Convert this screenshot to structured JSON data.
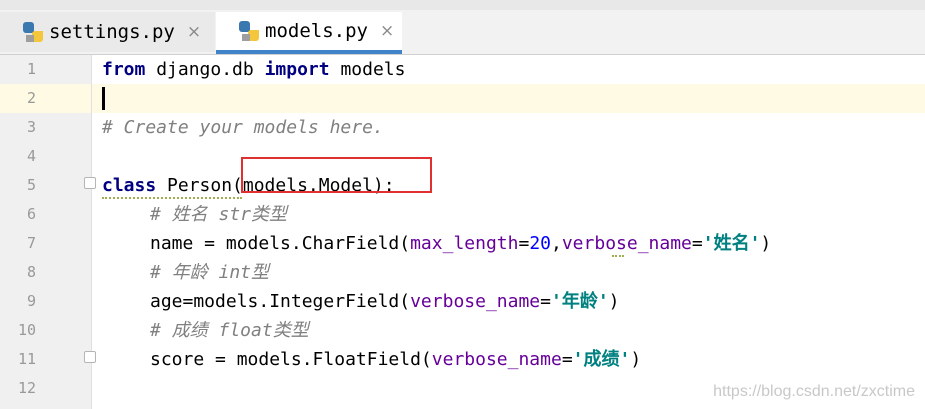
{
  "tabs": [
    {
      "label": "settings.py",
      "icon": "python-file-icon",
      "active": false
    },
    {
      "label": "models.py",
      "icon": "python-file-icon",
      "active": true
    }
  ],
  "close_glyph": "×",
  "line_numbers": [
    "1",
    "2",
    "3",
    "4",
    "5",
    "6",
    "7",
    "8",
    "9",
    "10",
    "11",
    "12"
  ],
  "code": {
    "l1": {
      "kw1": "from",
      "t1": " django.db ",
      "kw2": "import",
      "t2": " models"
    },
    "l3": {
      "comment": "# Create your models here."
    },
    "l5": {
      "kw": "class",
      "t1": " Person",
      "t2": "(models.Model):"
    },
    "l6": {
      "comment": "# 姓名 str类型"
    },
    "l7": {
      "t1": "name = models.CharField(",
      "p1": "max_length",
      "t2": "=",
      "n1": "20",
      "t3": ",",
      "p2": "verbose_name",
      "t4": "=",
      "s1": "'姓名'",
      "t5": ")"
    },
    "l8": {
      "comment": "# 年龄 int型"
    },
    "l9": {
      "t1": "age=models.IntegerField(",
      "p1": "verbose_name",
      "t2": "=",
      "s1": "'年龄'",
      "t3": ")"
    },
    "l10": {
      "comment": "# 成绩 float类型"
    },
    "l11": {
      "t1": "score = models.FloatField(",
      "p1": "verbose_name",
      "t2": "=",
      "s1": "'成绩'",
      "t3": ")"
    }
  },
  "watermark": "https://blog.csdn.net/zxctime",
  "colors": {
    "keyword": "#000080",
    "comment": "#808080",
    "param": "#660099",
    "number": "#0000ff",
    "string": "#008080",
    "highlight_box": "#e03030",
    "active_tab": "#4083c9"
  }
}
